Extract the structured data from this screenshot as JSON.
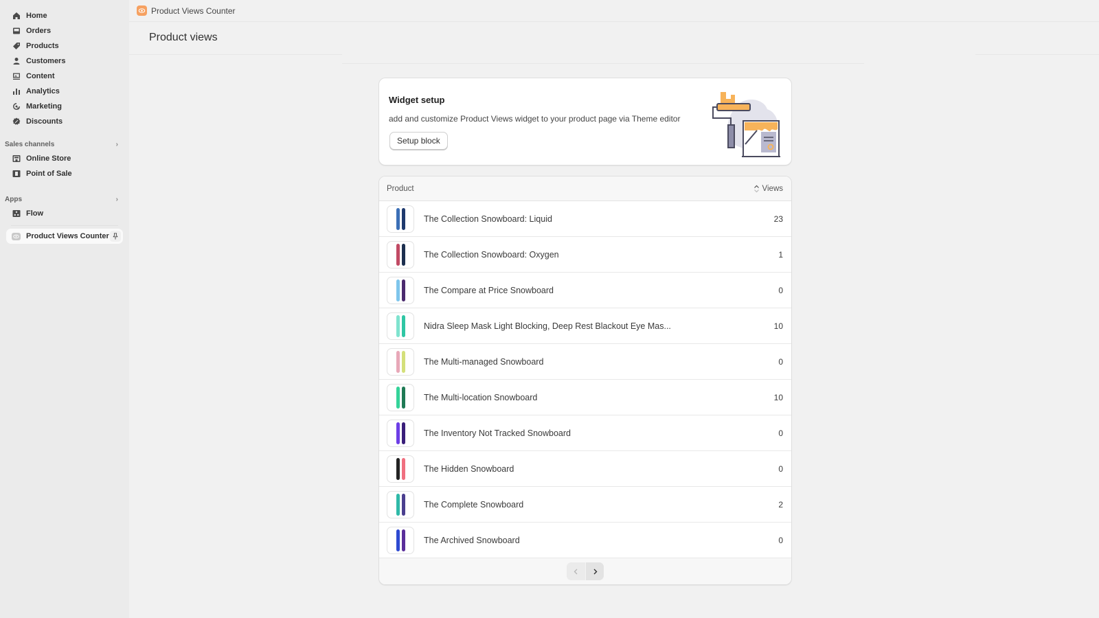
{
  "sidebar": {
    "nav": [
      {
        "label": "Home",
        "icon": "home-icon"
      },
      {
        "label": "Orders",
        "icon": "orders-icon"
      },
      {
        "label": "Products",
        "icon": "tag-icon"
      },
      {
        "label": "Customers",
        "icon": "person-icon"
      },
      {
        "label": "Content",
        "icon": "content-icon"
      },
      {
        "label": "Analytics",
        "icon": "bar-chart-icon"
      },
      {
        "label": "Marketing",
        "icon": "target-icon"
      },
      {
        "label": "Discounts",
        "icon": "discount-icon"
      }
    ],
    "sales_channels": {
      "label": "Sales channels",
      "items": [
        {
          "label": "Online Store",
          "icon": "store-icon"
        },
        {
          "label": "Point of Sale",
          "icon": "pos-icon"
        }
      ]
    },
    "apps": {
      "label": "Apps",
      "items": [
        {
          "label": "Flow",
          "icon": "flow-icon"
        }
      ]
    },
    "active_app": {
      "label": "Product Views Counter",
      "icon": "eye-icon",
      "pin_icon": "pin-icon"
    }
  },
  "topbar": {
    "app_name": "Product Views Counter"
  },
  "page": {
    "title": "Product views"
  },
  "widget": {
    "title": "Widget setup",
    "description": "add and customize Product Views widget to your product page via Theme editor",
    "button_label": "Setup block"
  },
  "table": {
    "columns": {
      "product": "Product",
      "views": "Views"
    },
    "rows": [
      {
        "name": "The Collection Snowboard: Liquid",
        "views": "23",
        "colors": [
          "#3b6fb6",
          "#1f3a6e"
        ]
      },
      {
        "name": "The Collection Snowboard: Oxygen",
        "views": "1",
        "colors": [
          "#c14a64",
          "#1c2f4f"
        ]
      },
      {
        "name": "The Compare at Price Snowboard",
        "views": "0",
        "colors": [
          "#7ec5ec",
          "#4b2a6e"
        ]
      },
      {
        "name": "Nidra Sleep Mask Light Blocking, Deep Rest Blackout Eye Mas...",
        "views": "10",
        "colors": [
          "#7fe3cf",
          "#2fc6a4"
        ]
      },
      {
        "name": "The Multi-managed Snowboard",
        "views": "0",
        "colors": [
          "#e8a8b8",
          "#d4e07a"
        ]
      },
      {
        "name": "The Multi-location Snowboard",
        "views": "10",
        "colors": [
          "#34d399",
          "#1f7a55"
        ]
      },
      {
        "name": "The Inventory Not Tracked Snowboard",
        "views": "0",
        "colors": [
          "#6d3ee6",
          "#3a1e7a"
        ]
      },
      {
        "name": "The Hidden Snowboard",
        "views": "0",
        "colors": [
          "#222222",
          "#f07080"
        ]
      },
      {
        "name": "The Complete Snowboard",
        "views": "2",
        "colors": [
          "#2fb9a8",
          "#4b3f8f"
        ]
      },
      {
        "name": "The Archived Snowboard",
        "views": "0",
        "colors": [
          "#2e4ad1",
          "#5a2e9a"
        ]
      }
    ]
  },
  "pagination": {
    "prev_icon": "chevron-left-icon",
    "next_icon": "chevron-right-icon"
  },
  "colors": {
    "app_accent": "#f6a161",
    "page_bg": "#f1f1f1",
    "sidebar_bg": "#ebebeb"
  }
}
